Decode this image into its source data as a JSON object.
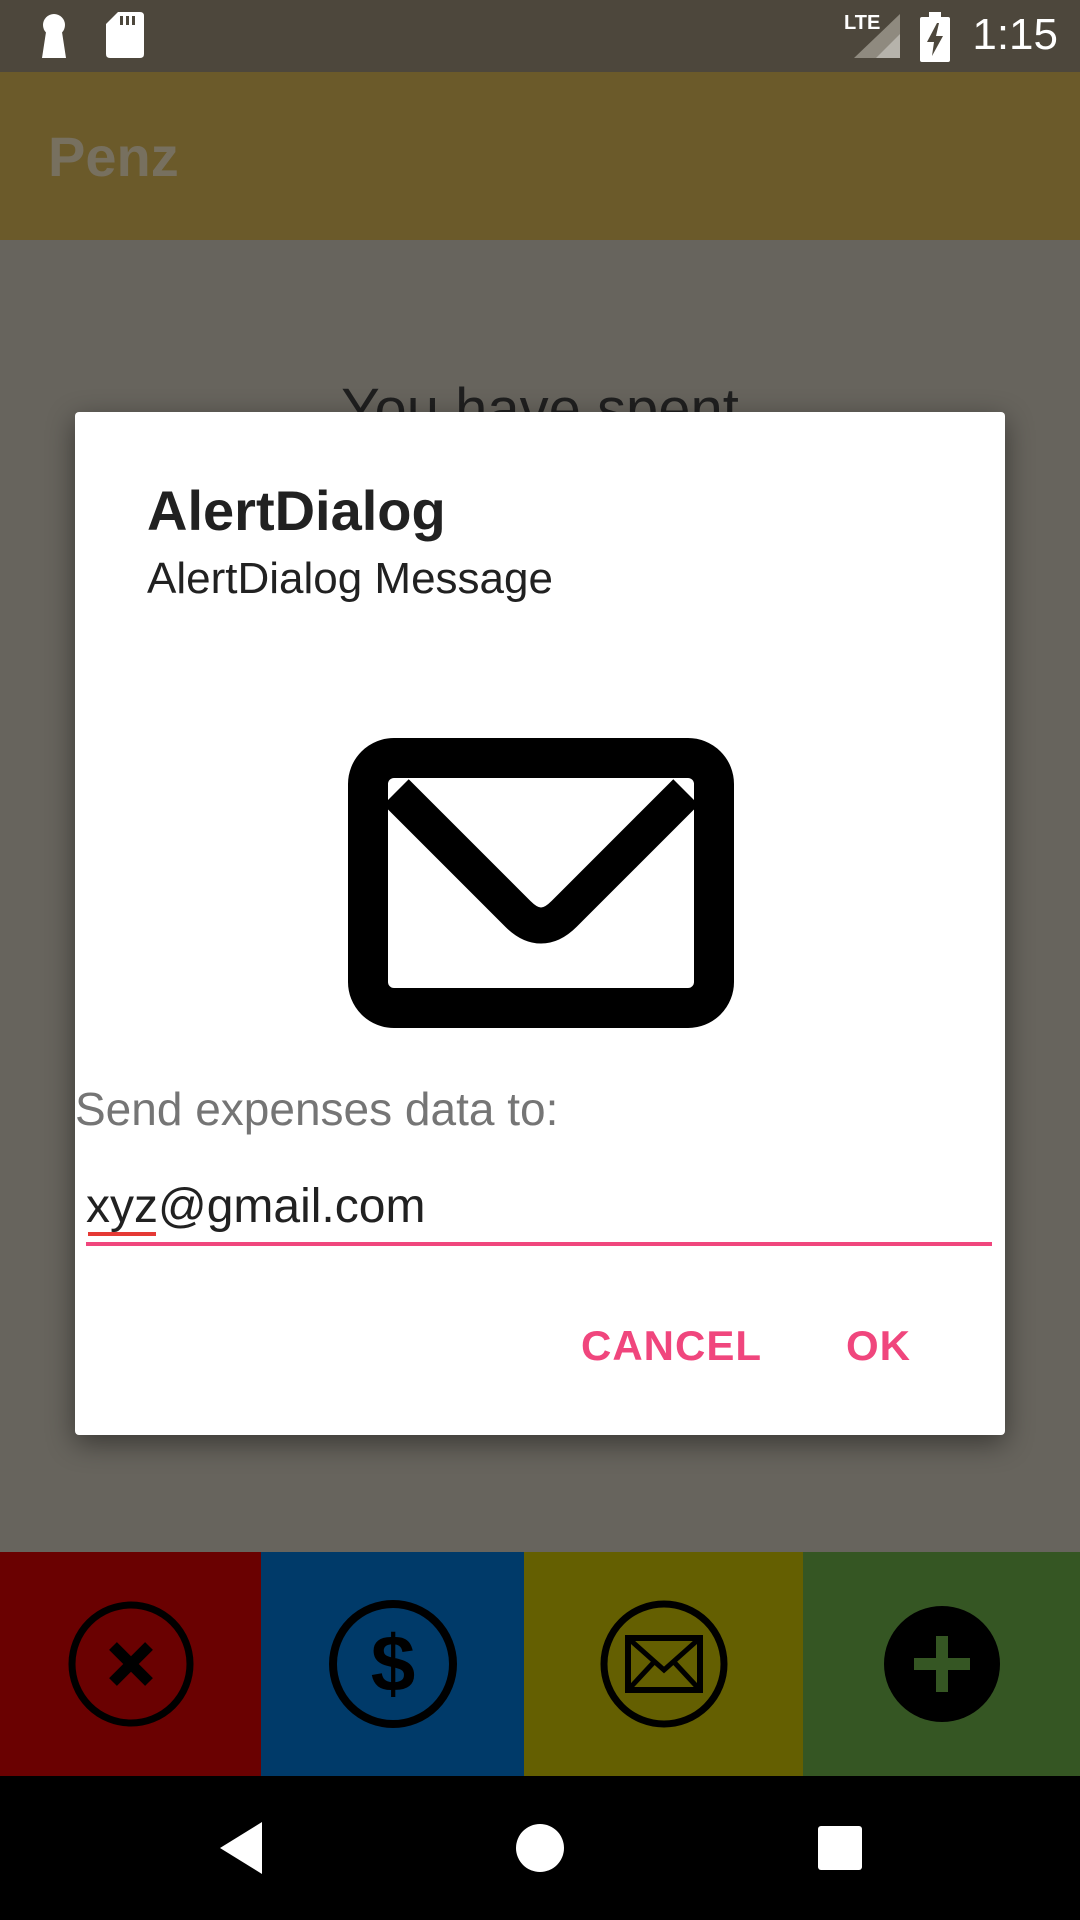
{
  "status_bar": {
    "time": "1:15",
    "network": "LTE",
    "icons": [
      "keyhole-icon",
      "sd-card-icon",
      "signal-icon",
      "battery-charging-icon"
    ]
  },
  "app_bar": {
    "title": "Penz"
  },
  "content": {
    "spent_text": "You have spent"
  },
  "dialog": {
    "title": "AlertDialog",
    "message": "AlertDialog Message",
    "icon": "envelope-icon",
    "prompt": "Send expenses data to:",
    "email_value": "xyz@gmail.com",
    "cancel_label": "CANCEL",
    "ok_label": "OK",
    "accent_color": "#f0467d"
  },
  "action_bar": {
    "buttons": [
      {
        "icon": "close-icon",
        "color": "#6a0101"
      },
      {
        "icon": "dollar-icon",
        "color": "#003a69"
      },
      {
        "icon": "mail-icon",
        "color": "#645f01"
      },
      {
        "icon": "add-icon",
        "color": "#355623"
      }
    ]
  },
  "nav_bar": {
    "icons": [
      "back-icon",
      "home-icon",
      "recents-icon"
    ]
  }
}
